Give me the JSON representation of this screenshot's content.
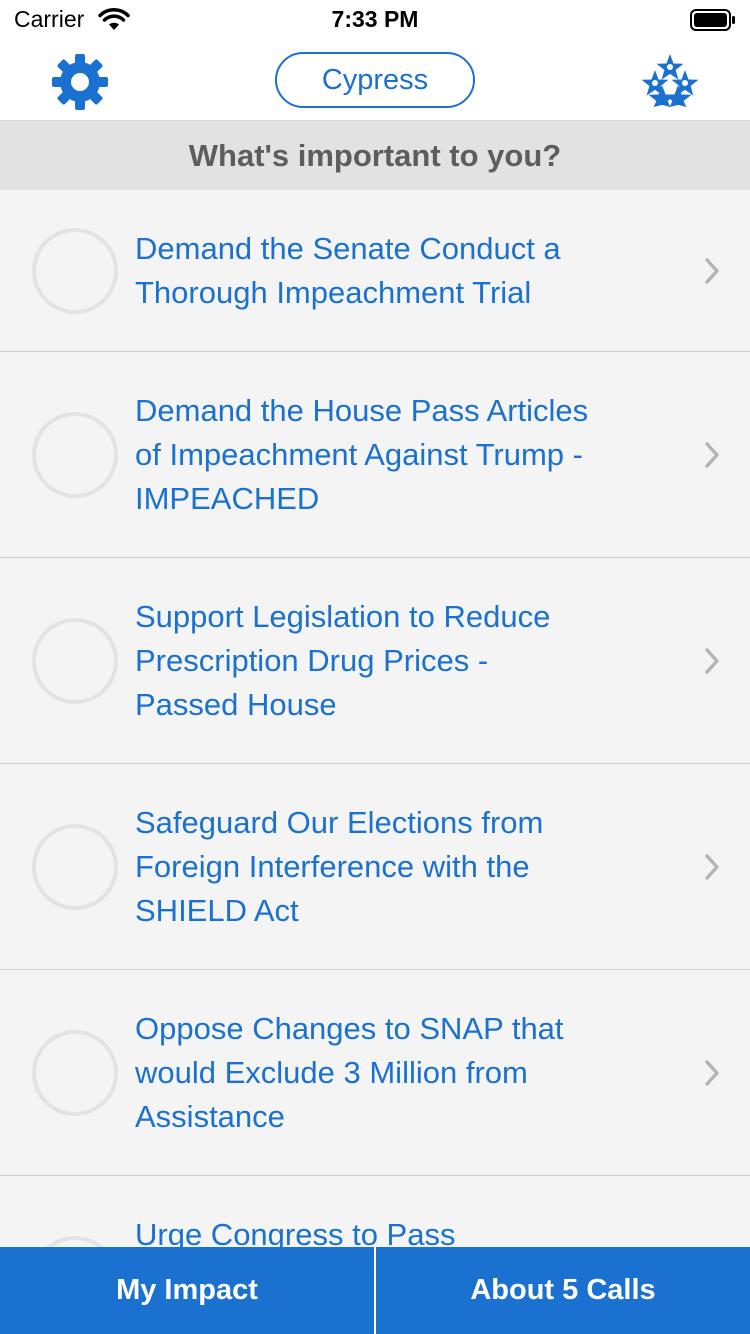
{
  "status_bar": {
    "carrier": "Carrier",
    "time": "7:33 PM"
  },
  "nav": {
    "location": "Cypress",
    "settings_icon": "gear-icon",
    "stars_icon": "stars-icon"
  },
  "section_header": "What's important to you?",
  "issues": [
    {
      "lines": [
        "Demand the Senate Conduct a",
        "Thorough Impeachment Trial"
      ]
    },
    {
      "lines": [
        "Demand the House Pass Articles",
        "of Impeachment Against Trump -",
        "IMPEACHED"
      ]
    },
    {
      "lines": [
        "Support Legislation to Reduce",
        "Prescription Drug Prices -",
        "Passed House"
      ]
    },
    {
      "lines": [
        "Safeguard Our Elections from",
        "Foreign Interference with the",
        "SHIELD Act"
      ]
    },
    {
      "lines": [
        "Oppose Changes to SNAP that",
        "would Exclude 3 Million from",
        "Assistance"
      ]
    },
    {
      "lines": [
        "Urge Congress to Pass"
      ]
    }
  ],
  "tabs": {
    "my_impact": "My Impact",
    "about": "About 5 Calls"
  },
  "colors": {
    "accent": "#1a71d0",
    "header_bg": "#e2e2e2",
    "row_bg": "#f4f4f4"
  }
}
